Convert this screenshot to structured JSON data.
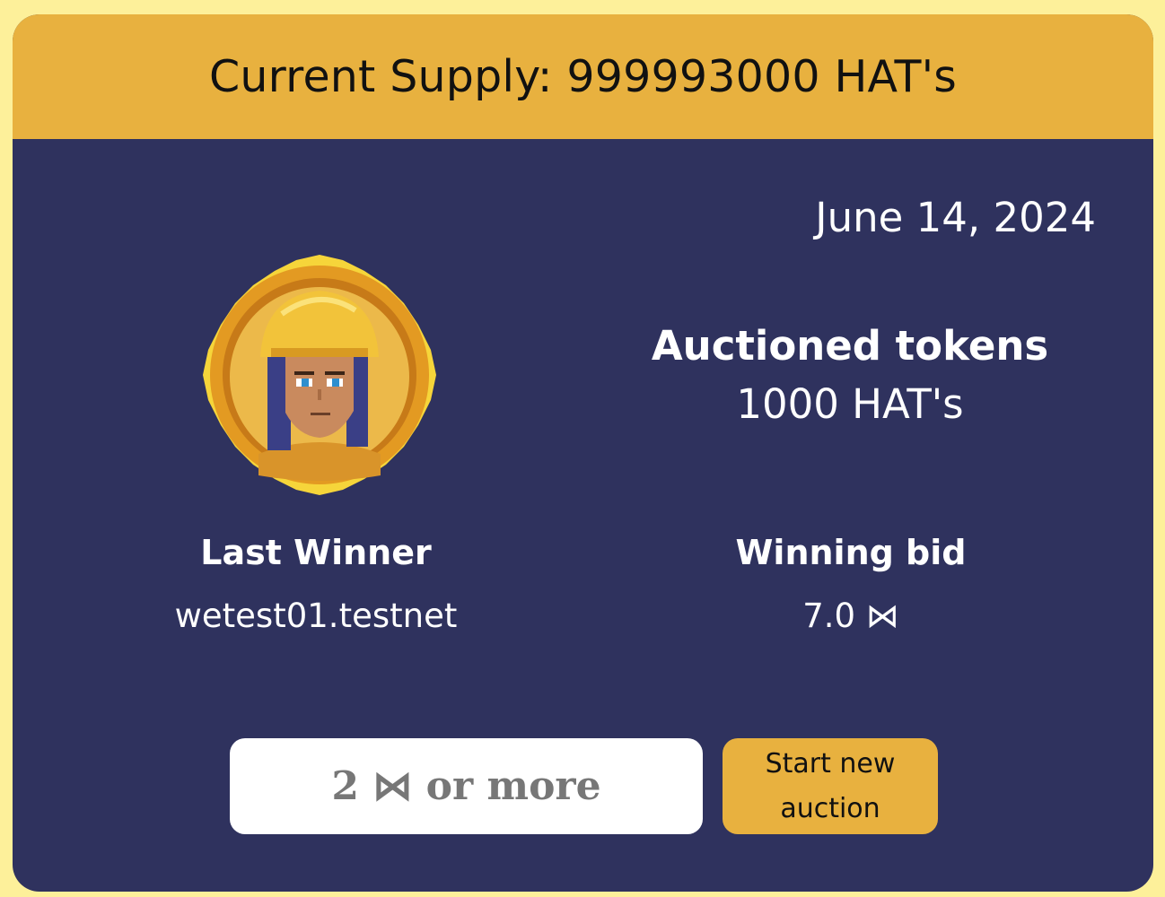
{
  "header": {
    "title": "Current Supply: 999993000 HAT's"
  },
  "auction": {
    "date": "June 14, 2024",
    "auctioned_label": "Auctioned tokens",
    "auctioned_value": "1000 HAT's",
    "last_winner_label": "Last Winner",
    "last_winner_value": "wetest01.testnet",
    "winning_bid_label": "Winning bid",
    "winning_bid_value": "7.0 ⋈"
  },
  "bid_form": {
    "placeholder": "2 ⋈ or more",
    "start_button_label": "Start new auction"
  },
  "avatar_icon": "hat-miner-coin-icon",
  "colors": {
    "page_background": "#fdf09a",
    "card_background": "#2f325e",
    "accent": "#e8b13f",
    "text_light": "#ffffff",
    "text_dark": "#111111"
  }
}
